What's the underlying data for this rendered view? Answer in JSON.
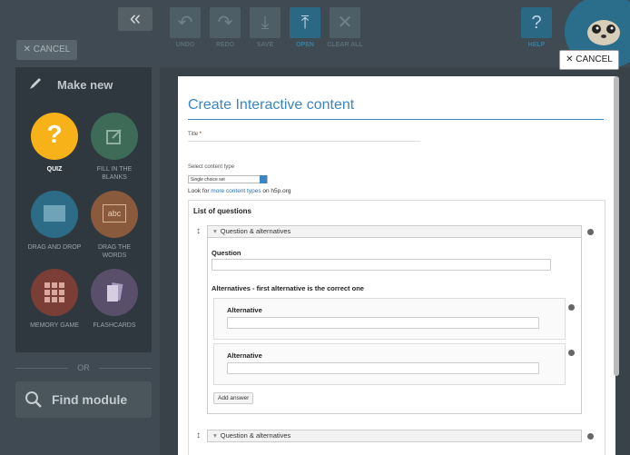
{
  "sidebar": {
    "collapse_icon": "double-chevron-left-icon",
    "cancel_label": "✕ CANCEL",
    "make_new_label": "Make new",
    "tiles": [
      {
        "label": "QUIZ",
        "icon": "question-icon",
        "color": "#f7b21a",
        "active": true
      },
      {
        "label": "FILL IN THE BLANKS",
        "icon": "edit-icon",
        "color": "#3d6b58",
        "active": false
      },
      {
        "label": "DRAG AND DROP",
        "icon": "drag-drop-icon",
        "color": "#2d6c86",
        "active": false
      },
      {
        "label": "DRAG THE WORDS",
        "icon": "abc-icon",
        "color": "#8a5a3c",
        "active": false
      },
      {
        "label": "MEMORY GAME",
        "icon": "grid-icon",
        "color": "#7a3e36",
        "active": false
      },
      {
        "label": "FLASHCARDS",
        "icon": "cards-icon",
        "color": "#5a4f6b",
        "active": false
      }
    ],
    "or_label": "OR",
    "find_label": "Find module"
  },
  "toolbar": {
    "buttons": [
      {
        "label": "UNDO",
        "icon": "undo-icon",
        "active": false
      },
      {
        "label": "REDO",
        "icon": "redo-icon",
        "active": false
      },
      {
        "label": "SAVE",
        "icon": "save-icon",
        "active": false
      },
      {
        "label": "OPEN",
        "icon": "upload-icon",
        "active": true
      },
      {
        "label": "CLEAR ALL",
        "icon": "close-icon",
        "active": false
      }
    ],
    "help_label": "HELP",
    "help_glyph": "?",
    "cancel_label": "✕ CANCEL"
  },
  "form": {
    "heading": "Create Interactive content",
    "title_label": "Title",
    "title_required": "*",
    "select_label": "Select content type",
    "select_value": "Single choice set",
    "look_prefix": "Look for ",
    "look_link": "more content types",
    "look_suffix": " on h5p.org",
    "list_title": "List of questions",
    "group_header": "Question & alternatives",
    "question_label": "Question",
    "alternatives_label": "Alternatives - first alternative is the correct one",
    "alternative_label": "Alternative",
    "add_answer": "Add answer"
  }
}
